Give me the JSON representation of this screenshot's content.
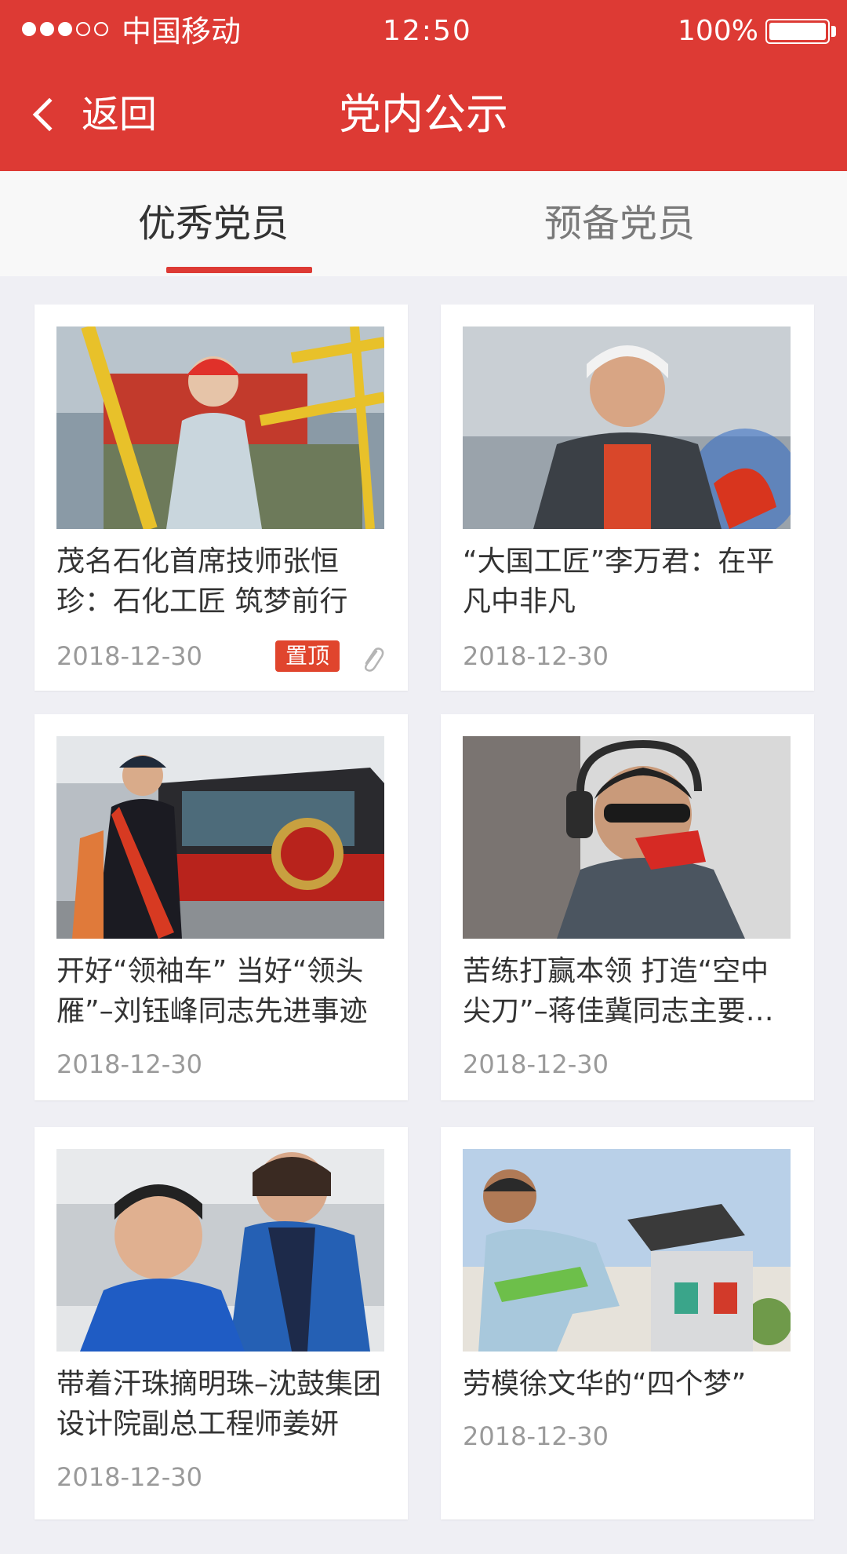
{
  "status_bar": {
    "carrier": "中国移动",
    "time": "12:50",
    "battery": "100%"
  },
  "nav": {
    "back_label": "返回",
    "title": "党内公示"
  },
  "tabs": [
    {
      "label": "优秀党员",
      "active": true
    },
    {
      "label": "预备党员",
      "active": false
    }
  ],
  "cards": [
    {
      "title": "茂名石化首席技师张恒珍：石化工匠 筑梦前行",
      "date": "2018-12-30",
      "badge": "置顶",
      "has_attachment": true,
      "image": "worker-icon"
    },
    {
      "title": "“大国工匠”李万君：在平凡中非凡",
      "date": "2018-12-30",
      "image": "welder-icon"
    },
    {
      "title": "开好“领袖车” 当好“领头雁”–刘钰峰同志先进事迹",
      "date": "2018-12-30",
      "image": "train-icon"
    },
    {
      "title": "苦练打赢本领 打造“空中尖刀”–蒋佳冀同志主要…",
      "date": "2018-12-30",
      "image": "pilot-icon"
    },
    {
      "title": "带着汗珠摘明珠–沈鼓集团设计院副总工程师姜妍",
      "date": "2018-12-30",
      "image": "engineer-icon"
    },
    {
      "title": "劳模徐文华的“四个梦”",
      "date": "2018-12-30",
      "image": "sanitation-icon"
    }
  ],
  "colors": {
    "brand_red": "#dd3a34",
    "badge_red": "#e0452d",
    "background": "#efeff4"
  }
}
